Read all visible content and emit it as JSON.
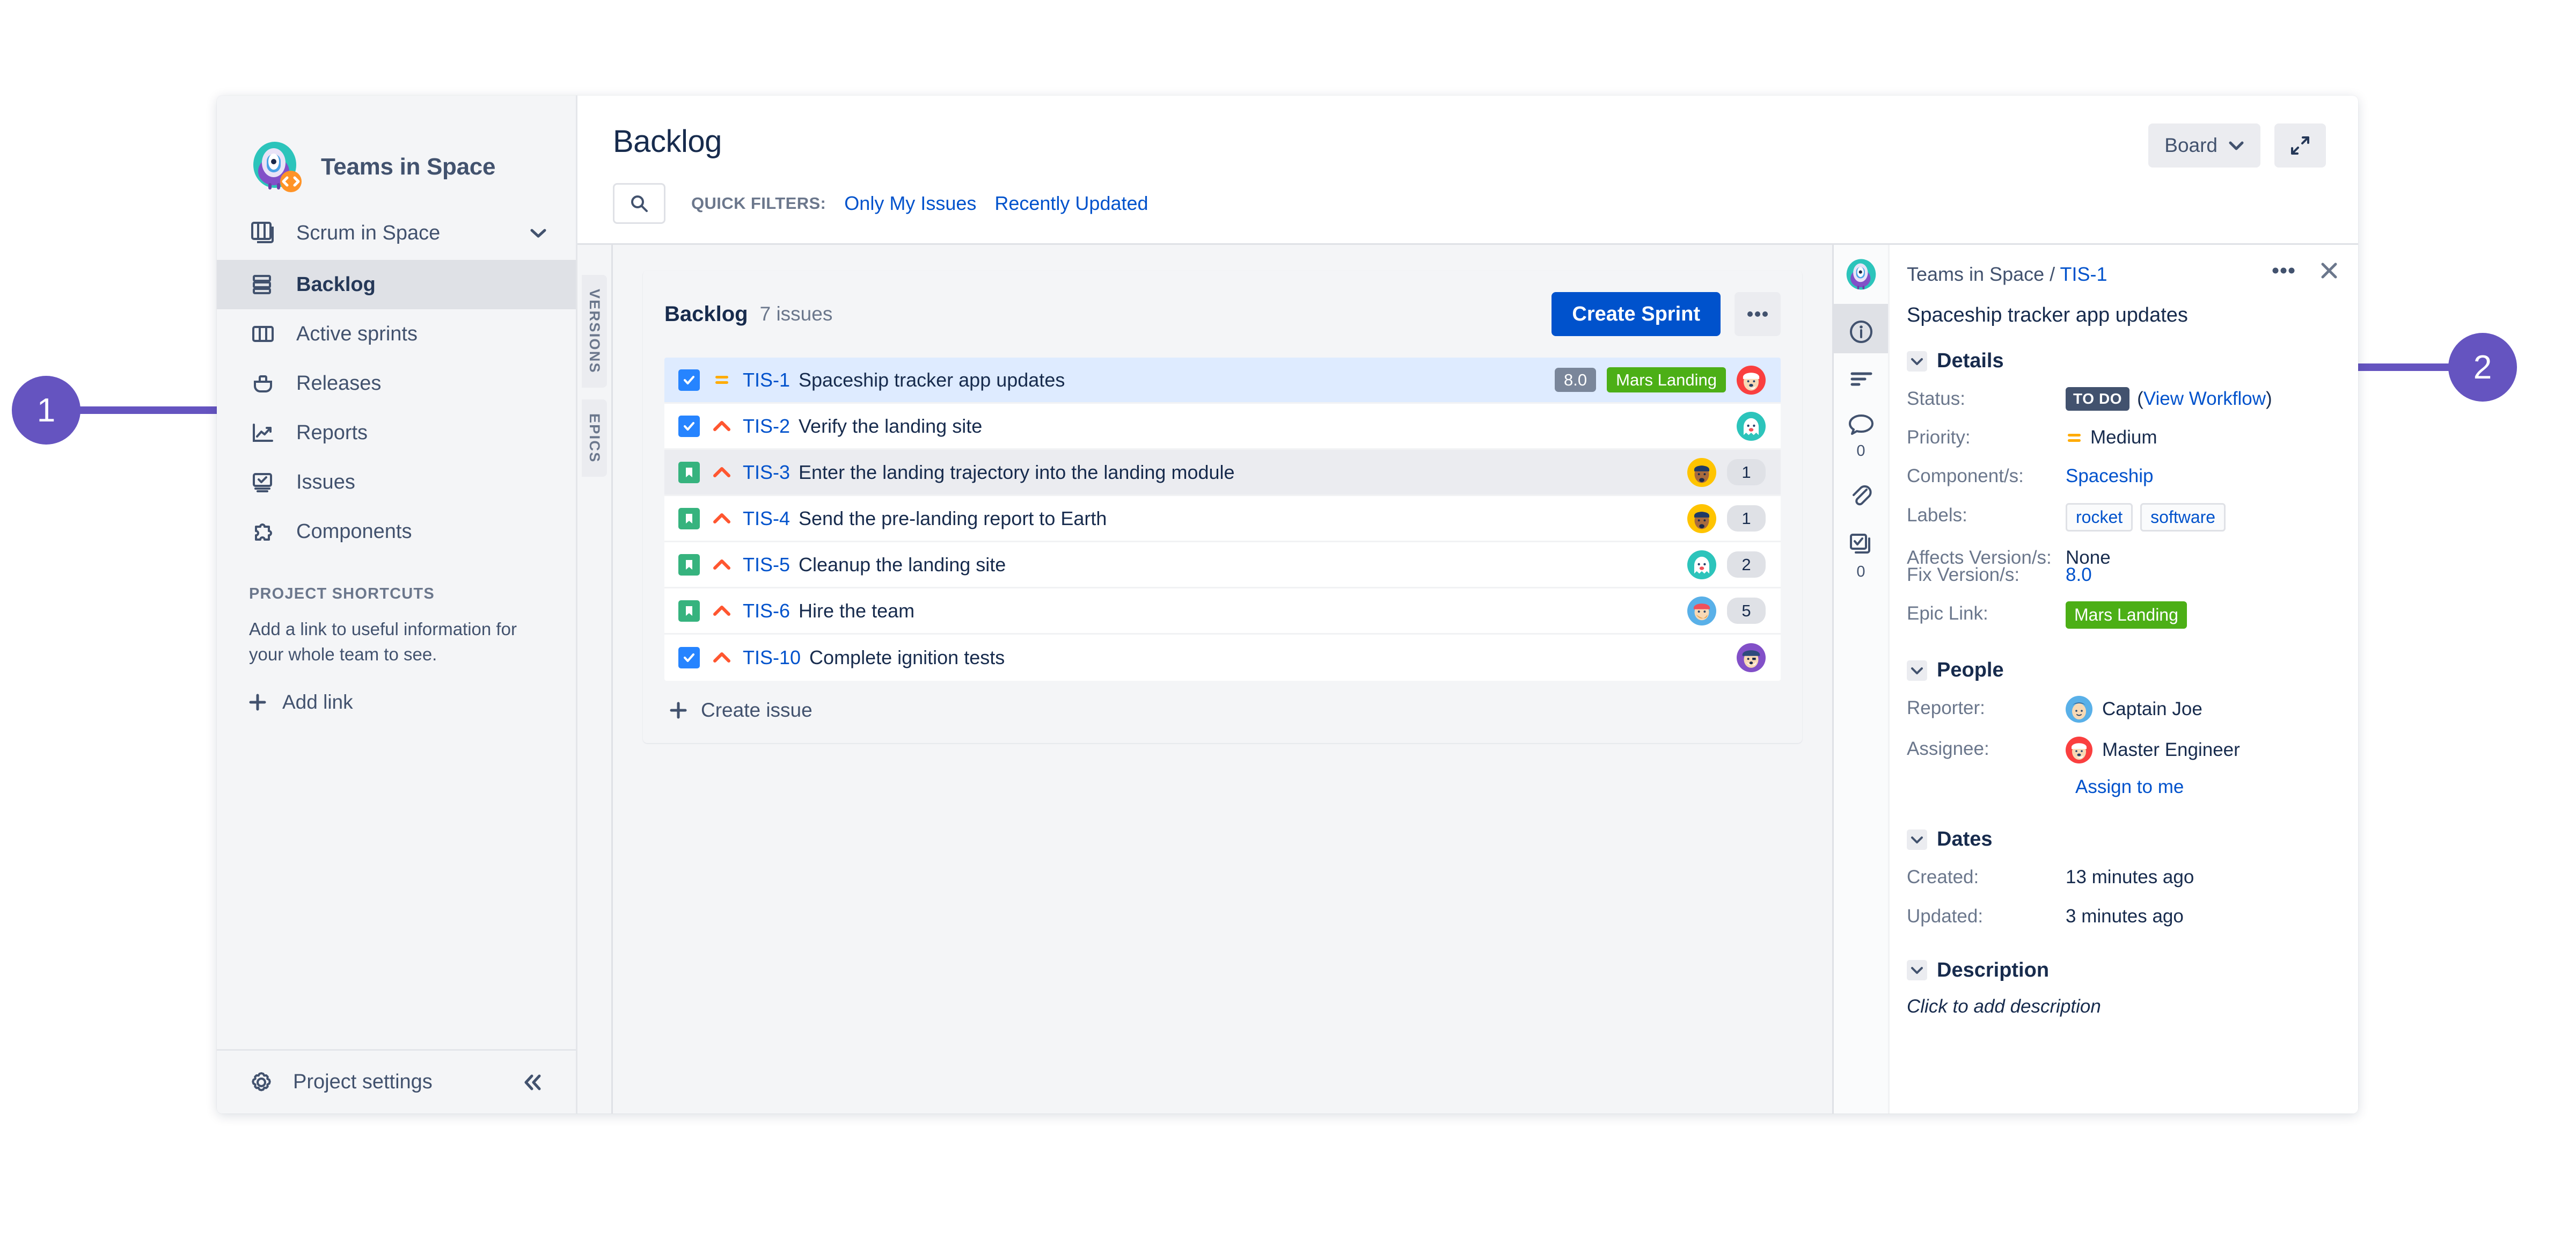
{
  "sidebar": {
    "project_name": "Teams in Space",
    "logo_icon": "space-monkey-avatar-icon",
    "board_selector": {
      "label": "Scrum in Space",
      "icon": "board-icon",
      "caret": "chevron-down-icon"
    },
    "items": [
      {
        "label": "Backlog",
        "icon": "backlog-icon",
        "active": true
      },
      {
        "label": "Active sprints",
        "icon": "columns-board-icon",
        "active": false
      },
      {
        "label": "Releases",
        "icon": "releases-ship-icon",
        "active": false
      },
      {
        "label": "Reports",
        "icon": "reports-chart-icon",
        "active": false
      },
      {
        "label": "Issues",
        "icon": "issues-screen-icon",
        "active": false
      },
      {
        "label": "Components",
        "icon": "components-puzzle-icon",
        "active": false
      }
    ],
    "shortcuts_title": "PROJECT SHORTCUTS",
    "shortcuts_description": "Add a link to useful information for your whole team to see.",
    "add_link_label": "Add link",
    "add_link_icon": "plus-icon",
    "project_settings_label": "Project settings",
    "project_settings_icon": "gear-icon",
    "collapse_icon": "double-chevron-left-icon"
  },
  "header": {
    "title": "Backlog",
    "search_icon": "search-icon",
    "search_placeholder": "",
    "quick_filters_label": "QUICK FILTERS:",
    "quick_filters": [
      "Only My Issues",
      "Recently Updated"
    ],
    "board_button": {
      "label": "Board",
      "caret": "chevron-down-icon"
    },
    "expand_button_icon": "expand-diagonal-icon"
  },
  "vertical_tabs": [
    "VERSIONS",
    "EPICS"
  ],
  "backlog": {
    "name": "Backlog",
    "issue_count": "7 issues",
    "create_sprint_label": "Create Sprint",
    "more_icon": "ellipsis-icon",
    "create_issue_label": "Create issue",
    "create_issue_icon": "plus-icon",
    "issues": [
      {
        "type": "task",
        "type_icon": "task-checkbox-icon",
        "priority": "medium",
        "priority_icon": "priority-medium-icon",
        "key": "TIS-1",
        "summary": "Spaceship tracker app updates",
        "estimate": "8.0",
        "epic": "Mars Landing",
        "avatar": "santa-red",
        "count": "",
        "state": "selected"
      },
      {
        "type": "task",
        "type_icon": "task-checkbox-icon",
        "priority": "high",
        "priority_icon": "priority-high-icon",
        "key": "TIS-2",
        "summary": "Verify the landing site",
        "estimate": "",
        "epic": "",
        "avatar": "ghost-teal",
        "count": "",
        "state": "normal"
      },
      {
        "type": "story",
        "type_icon": "story-bookmark-icon",
        "priority": "high",
        "priority_icon": "priority-high-icon",
        "key": "TIS-3",
        "summary": "Enter the landing trajectory into the landing module",
        "estimate": "",
        "epic": "",
        "avatar": "man-yellow",
        "count": "1",
        "state": "hovered"
      },
      {
        "type": "story",
        "type_icon": "story-bookmark-icon",
        "priority": "high",
        "priority_icon": "priority-high-icon",
        "key": "TIS-4",
        "summary": "Send the pre-landing report to Earth",
        "estimate": "",
        "epic": "",
        "avatar": "man-yellow",
        "count": "1",
        "state": "normal"
      },
      {
        "type": "story",
        "type_icon": "story-bookmark-icon",
        "priority": "high",
        "priority_icon": "priority-high-icon",
        "key": "TIS-5",
        "summary": "Cleanup the landing site",
        "estimate": "",
        "epic": "",
        "avatar": "ghost-teal",
        "count": "2",
        "state": "normal"
      },
      {
        "type": "story",
        "type_icon": "story-bookmark-icon",
        "priority": "high",
        "priority_icon": "priority-high-icon",
        "key": "TIS-6",
        "summary": "Hire the team",
        "estimate": "",
        "epic": "",
        "avatar": "beard-blue",
        "count": "5",
        "state": "normal"
      },
      {
        "type": "task",
        "type_icon": "task-checkbox-icon",
        "priority": "high",
        "priority_icon": "priority-high-icon",
        "key": "TIS-10",
        "summary": "Complete ignition tests",
        "estimate": "",
        "epic": "",
        "avatar": "captain-purple",
        "count": "",
        "state": "normal"
      }
    ]
  },
  "detail": {
    "rail": [
      {
        "name": "details-info",
        "icon": "info-circle-icon",
        "count": "",
        "active": true
      },
      {
        "name": "activity",
        "icon": "activity-lines-icon",
        "count": "",
        "active": false
      },
      {
        "name": "comments",
        "icon": "comment-bubble-icon",
        "count": "0",
        "active": false
      },
      {
        "name": "attachments",
        "icon": "paperclip-icon",
        "count": "",
        "active": false
      },
      {
        "name": "subtasks",
        "icon": "subtasks-checkbox-icon",
        "count": "0",
        "active": false
      }
    ],
    "breadcrumb_project": "Teams in Space",
    "breadcrumb_separator": " / ",
    "breadcrumb_key": "TIS-1",
    "summary": "Spaceship tracker app updates",
    "more_icon": "ellipsis-icon",
    "close_icon": "close-icon",
    "sections": {
      "details": {
        "title": "Details",
        "chevron": "chevron-down-icon",
        "status_label": "Status:",
        "status_value": "TO DO",
        "status_workflow_prefix": "(",
        "status_workflow_link": "View Workflow",
        "status_workflow_suffix": ")",
        "priority_label": "Priority:",
        "priority_value": "Medium",
        "priority_icon": "priority-medium-icon",
        "component_label": "Component/s:",
        "component_value": "Spaceship",
        "labels_label": "Labels:",
        "labels_values": [
          "rocket",
          "software"
        ],
        "affects_label": "Affects Version/s:",
        "affects_value": "None",
        "fix_label": "Fix Version/s:",
        "fix_value": "8.0",
        "epic_label": "Epic Link:",
        "epic_value": "Mars Landing"
      },
      "people": {
        "title": "People",
        "chevron": "chevron-down-icon",
        "reporter_label": "Reporter:",
        "reporter_value": "Captain Joe",
        "reporter_avatar": "captain-blue",
        "assignee_label": "Assignee:",
        "assignee_value": "Master Engineer",
        "assignee_avatar": "santa-red",
        "assign_to_me": "Assign to me"
      },
      "dates": {
        "title": "Dates",
        "chevron": "chevron-down-icon",
        "created_label": "Created:",
        "created_value": "13 minutes ago",
        "updated_label": "Updated:",
        "updated_value": "3 minutes ago"
      },
      "description": {
        "title": "Description",
        "chevron": "chevron-down-icon",
        "placeholder": "Click to add description"
      }
    }
  },
  "callouts": [
    {
      "number": "1",
      "color": "#6554c0"
    },
    {
      "number": "2",
      "color": "#6554c0"
    }
  ],
  "colors": {
    "accent_blue": "#0052cc",
    "link_blue": "#0052cc",
    "epic_green": "#4caf16",
    "story_green": "#36b37e",
    "task_blue": "#2684ff",
    "priority_high_red": "#ff5630",
    "priority_medium_orange": "#ffab00",
    "callout_purple": "#6554c0",
    "status_grey": "#42526e",
    "text_primary": "#172b4d",
    "text_subtle": "#6b778c"
  }
}
